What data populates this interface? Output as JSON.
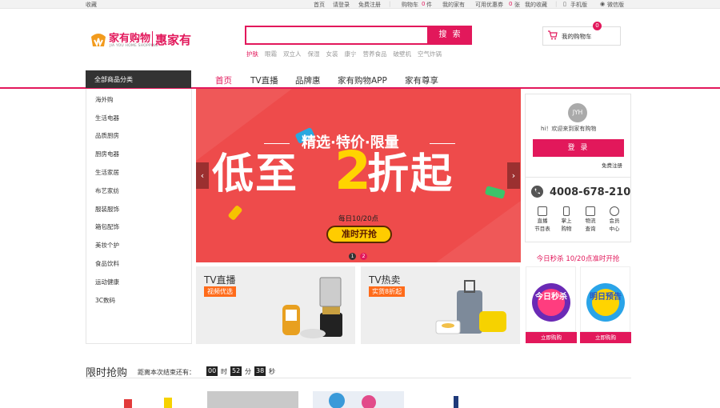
{
  "topbar": {
    "favorite": "收藏",
    "links": [
      "首页",
      "请登录",
      "免费注册",
      "购物车",
      "0",
      "件",
      "我的家有",
      "可用优惠券",
      "0",
      "张",
      "我的收藏",
      "手机版",
      "微信版"
    ]
  },
  "header": {
    "logo_cn": "家有购物",
    "logo_en": "JIA YOU HOME SHOPPING",
    "slogan": "惠家有",
    "search_button": "搜 索",
    "search_value": "",
    "hotwords": [
      "护肤",
      "眼霜",
      "双立人",
      "保湿",
      "女装",
      "康宁",
      "营养食品",
      "破壁机",
      "空气炸锅"
    ],
    "cart_label": "我的购物车",
    "cart_count": "0"
  },
  "nav": {
    "all_categories": "全部商品分类",
    "items": [
      "首页",
      "TV直播",
      "品牌惠",
      "家有购物APP",
      "家有尊享"
    ]
  },
  "categories": [
    "海外购",
    "生活电器",
    "品质厨房",
    "厨房电器",
    "生活家居",
    "布艺家纺",
    "服装服饰",
    "箱包配饰",
    "美妆个护",
    "食品饮料",
    "运动健康",
    "3C数码"
  ],
  "banner": {
    "subtitle": "精选·特价·限量",
    "main_text": "低至",
    "main_num": "2",
    "main_suffix": "折起",
    "time": "每日10/20点",
    "button": "准时开抢",
    "prev": "‹",
    "next": "›",
    "dots": [
      "1",
      "2"
    ]
  },
  "sub_banners": [
    {
      "title": "TV直播",
      "tag": "视频优选"
    },
    {
      "title": "TV热卖",
      "tag": "实货8折起"
    }
  ],
  "user": {
    "avatar_text": "JYH",
    "welcome": "hi！欢迎来到家有购物",
    "login": "登 录",
    "register": "免费注册",
    "phone": "4008-678-210",
    "services": [
      {
        "line1": "直播",
        "line2": "节目表"
      },
      {
        "line1": "掌上",
        "line2": "购物"
      },
      {
        "line1": "物流",
        "line2": "查询"
      },
      {
        "line1": "会员",
        "line2": "中心"
      }
    ]
  },
  "seckill": {
    "title": "今日秒杀 10/20点准时开抢",
    "badge1": "今日秒杀",
    "badge2": "明日预告",
    "buttons": [
      "立即购购",
      "立即购购"
    ]
  },
  "flash": {
    "title": "限时抢购",
    "subtitle": "距离本次结束还有：",
    "hours": "00",
    "hours_unit": "时",
    "minutes": "52",
    "minutes_unit": "分",
    "seconds": "38",
    "seconds_unit": "秒"
  },
  "colors": {
    "brand": "#e2185b",
    "banner_bg": "#ee4b4b",
    "highlight": "#ffd400"
  }
}
